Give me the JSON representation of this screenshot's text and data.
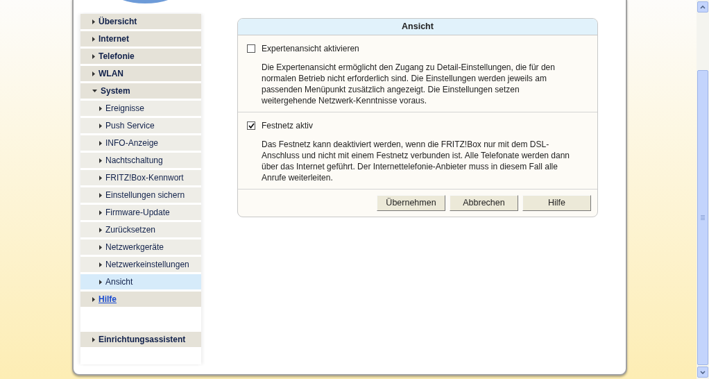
{
  "nav": {
    "items": [
      {
        "label": "Übersicht",
        "kind": "section",
        "selected": false,
        "expanded": false
      },
      {
        "label": "Internet",
        "kind": "section",
        "selected": false,
        "expanded": false
      },
      {
        "label": "Telefonie",
        "kind": "section",
        "selected": false,
        "expanded": false
      },
      {
        "label": "WLAN",
        "kind": "section",
        "selected": false,
        "expanded": false
      },
      {
        "label": "System",
        "kind": "section",
        "selected": false,
        "expanded": true,
        "children": [
          {
            "label": "Ereignisse",
            "selected": false
          },
          {
            "label": "Push Service",
            "selected": false
          },
          {
            "label": "INFO-Anzeige",
            "selected": false
          },
          {
            "label": "Nachtschaltung",
            "selected": false
          },
          {
            "label": "FRITZ!Box-Kennwort",
            "selected": false
          },
          {
            "label": "Einstellungen sichern",
            "selected": false
          },
          {
            "label": "Firmware-Update",
            "selected": false
          },
          {
            "label": "Zurücksetzen",
            "selected": false
          },
          {
            "label": "Netzwerkgeräte",
            "selected": false
          },
          {
            "label": "Netzwerkeinstellungen",
            "selected": false
          },
          {
            "label": "Ansicht",
            "selected": true
          }
        ]
      },
      {
        "label": "Hilfe",
        "kind": "link",
        "selected": false,
        "expanded": false
      }
    ],
    "footer_items": [
      {
        "label": "Einrichtungsassistent",
        "kind": "section",
        "selected": false,
        "expanded": false
      }
    ]
  },
  "panel": {
    "title": "Ansicht",
    "options": [
      {
        "label": "Expertenansicht aktivieren",
        "checked": false,
        "description": "Die Expertenansicht ermöglicht den Zugang zu Detail-Einstellungen, die für den normalen Betrieb nicht erforderlich sind. Die Einstellungen werden jeweils am passenden Menüpunkt zusätzlich angezeigt. Die Einstellungen setzen weitergehende Netzwerk-Kenntnisse voraus."
      },
      {
        "label": "Festnetz aktiv",
        "checked": true,
        "description": "Das Festnetz kann deaktiviert werden, wenn die FRITZ!Box nur mit dem DSL-Anschluss und nicht mit einem Festnetz verbunden ist. Alle Telefonate werden dann über das Internet geführt. Der Internettelefonie-Anbieter muss in diesem Fall alle Anrufe weiterleiten."
      }
    ],
    "buttons": [
      "Übernehmen",
      "Abbrechen",
      "Hilfe"
    ]
  }
}
